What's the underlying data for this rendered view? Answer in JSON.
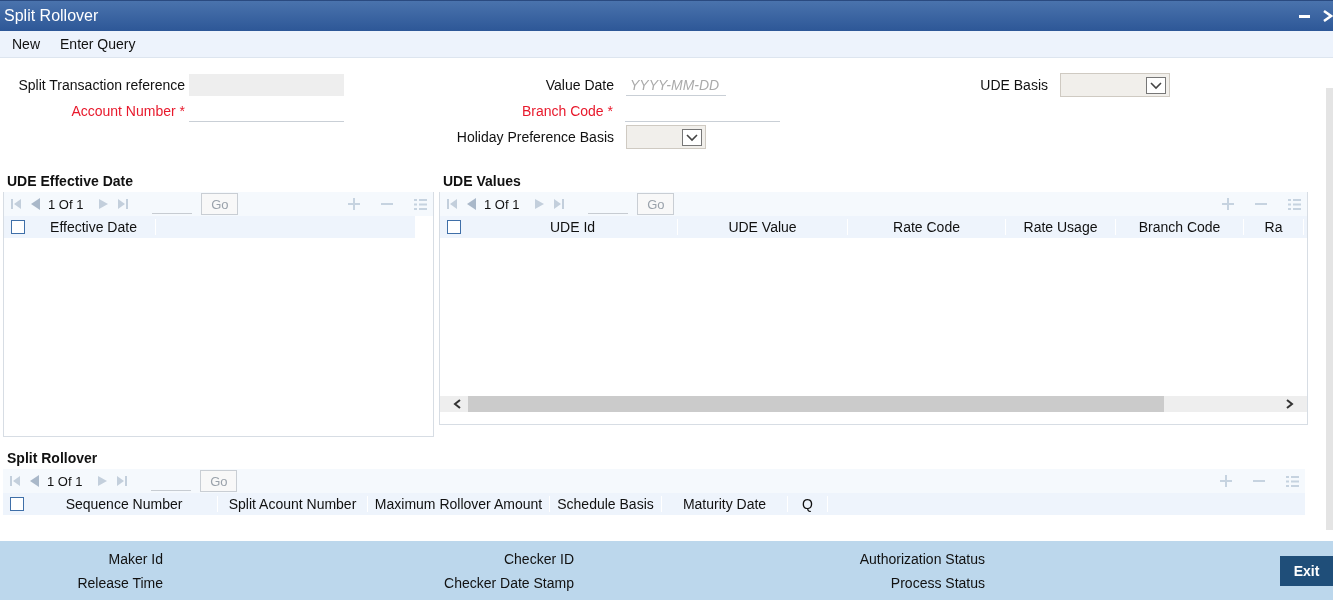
{
  "window": {
    "title": "Split Rollover"
  },
  "menu": [
    {
      "label": "New"
    },
    {
      "label": "Enter Query"
    }
  ],
  "form_columns": [
    {
      "fields": [
        {
          "label": "Split Transaction reference",
          "kind": "text",
          "required": false,
          "readonly": true
        },
        {
          "label": "Account Number *",
          "kind": "text",
          "required": true,
          "readonly": false
        }
      ]
    },
    {
      "fields": [
        {
          "label": "Value Date",
          "kind": "date",
          "required": false,
          "readonly": false,
          "placeholder": "YYYY-MM-DD"
        },
        {
          "label": "Branch Code *",
          "kind": "text",
          "required": true,
          "readonly": false
        },
        {
          "label": "Holiday Preference Basis",
          "kind": "select",
          "required": false
        }
      ]
    },
    {
      "fields": [
        {
          "label": "UDE Basis",
          "kind": "select",
          "required": false
        }
      ]
    }
  ],
  "grids": [
    {
      "title": "UDE Effective Date",
      "pager": "1 Of 1",
      "go": "Go",
      "checked": false,
      "columns": [
        "Effective Date"
      ]
    },
    {
      "title": "UDE Values",
      "pager": "1 Of 1",
      "go": "Go",
      "checked": false,
      "columns": [
        "UDE Id",
        "UDE Value",
        "Rate Code",
        "Rate Usage",
        "Branch Code",
        "Ra"
      ],
      "h_scrollbar": true
    },
    {
      "title": "Split Rollover",
      "pager": "1 Of 1",
      "go": "Go",
      "checked": false,
      "columns": [
        "Sequence Number",
        "Split Acount Number",
        "Maximum Rollover Amount",
        "Schedule Basis",
        "Maturity Date",
        "Q"
      ]
    }
  ],
  "footer": {
    "columns": [
      [
        "Maker Id",
        "Release Time"
      ],
      [
        "Checker ID",
        "Checker Date Stamp"
      ],
      [
        "Authorization Status",
        "Process Status"
      ]
    ],
    "exit": "Exit"
  }
}
